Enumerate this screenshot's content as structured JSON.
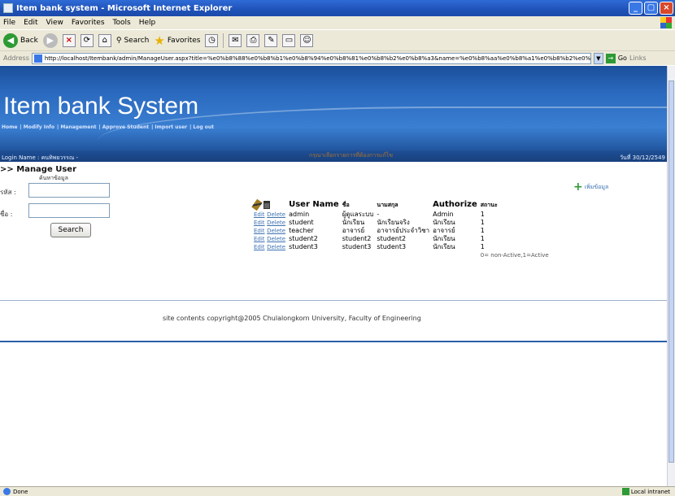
{
  "window": {
    "title": "Item bank system - Microsoft Internet Explorer",
    "buttons": [
      "_",
      "▢",
      "×"
    ]
  },
  "menu": [
    "File",
    "Edit",
    "View",
    "Favorites",
    "Tools",
    "Help"
  ],
  "toolbar": {
    "back_label": "Back",
    "search_label": "Search",
    "favorites_label": "Favorites"
  },
  "address": {
    "label": "Address",
    "url": "http://localhost/Itembank/admin/ManageUser.aspx?title=%e0%b8%88%e0%b8%b1%e0%b8%94%e0%b8%81%e0%b8%b2%e0%b8%a3&name=%e0%b8%aa%e0%b8%a1%e0%b8%b2%e0%b8%8a%e0%b8%b4%e0%b8%81",
    "go_label": "Go",
    "links_label": "Links"
  },
  "site": {
    "title": "Item bank System",
    "nav": [
      "Home",
      "Modify Info",
      "Management",
      "Approve Student",
      "Import user",
      "Log out"
    ],
    "login_name": "Login Name : คนทิพยวรรณ -",
    "date": "วันที่ 30/12/2549"
  },
  "manage": {
    "title": ">> Manage User",
    "search_heading": "ค้นหาข้อมูล",
    "field1_label": "รหัส :",
    "field2_label": "ชื่อ :",
    "search_button": "Search"
  },
  "list": {
    "title": "กรุณาเลือกรายการที่ต้องการแก้ไข",
    "add_label": "เพิ่มข้อมูล",
    "columns": [
      "User Name",
      "ชื่อ",
      "นามสกุล",
      "Authorize",
      "สถานะ"
    ],
    "edit_label": "Edit",
    "delete_label": "Delete",
    "rows": [
      {
        "username": "admin",
        "first": "ผู้ดูแลระบบ",
        "last": "-",
        "authorize": "Admin",
        "status": "1"
      },
      {
        "username": "student",
        "first": "นักเรียน",
        "last": "นักเรียนจริง",
        "authorize": "นักเรียน",
        "status": "1"
      },
      {
        "username": "teacher",
        "first": "อาจารย์",
        "last": "อาจารย์ประจำวิชา",
        "authorize": "อาจารย์",
        "status": "1"
      },
      {
        "username": "student2",
        "first": "student2",
        "last": "student2",
        "authorize": "นักเรียน",
        "status": "1"
      },
      {
        "username": "student3",
        "first": "student3",
        "last": "student3",
        "authorize": "นักเรียน",
        "status": "1"
      }
    ],
    "legend": "0= non-Active,1=Active"
  },
  "footer": {
    "copyright": "site contents copyright@2005 Chulalongkorn University, Faculty of Engineering"
  },
  "status": {
    "left": "Done",
    "zone": "Local intranet"
  }
}
